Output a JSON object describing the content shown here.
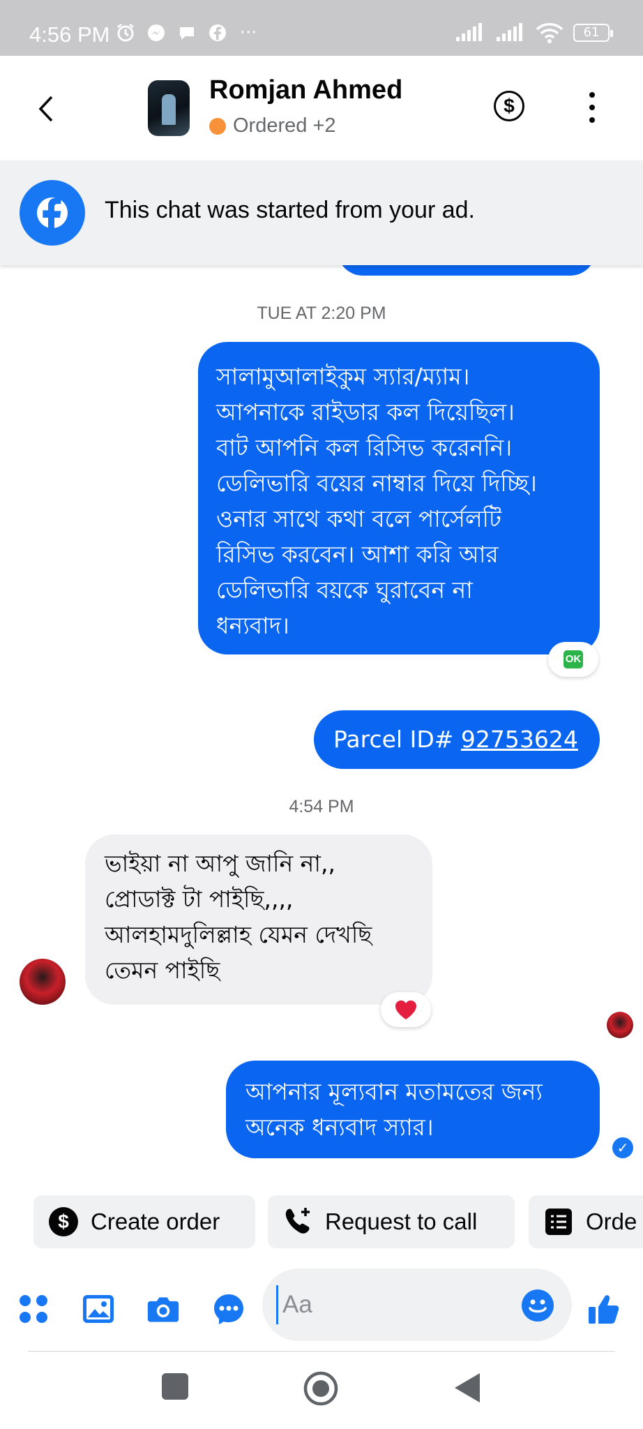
{
  "status_bar": {
    "time": "4:56 PM",
    "battery": "61"
  },
  "header": {
    "name": "Romjan Ahmed",
    "status": "Ordered +2"
  },
  "ad_banner": {
    "text": "This chat was started from your ad."
  },
  "messages": [
    {
      "time": "TUE AT 2:20 PM",
      "direction": "outgoing",
      "text": "সালামুআলাইকুম স্যার/ম্যাম।\nআপনাকে রাইডার কল দিয়েছিল।\nবাট আপনি কল রিসিভ করেননি।\nডেলিভারি বয়ের নাম্বার দিয়ে দিচ্ছি।\nওনার সাথে কথা বলে পার্সেলটি\nরিসিভ করবেন। আশা করি আর\nডেলিভারি বয়কে ঘুরাবেন না\nধন্যবাদ।",
      "reaction": "OK"
    },
    {
      "direction": "outgoing",
      "prefix": "Parcel ID# ",
      "link": "92753624"
    },
    {
      "time": "4:54 PM",
      "direction": "incoming",
      "text": "ভাইয়া না আপু জানি না,,\nপ্রোডাক্ট টা পাইছি,,,,\nআলহামদুলিল্লাহ যেমন দেখছি\nতেমন পাইছি",
      "reaction": "heart"
    },
    {
      "direction": "outgoing",
      "text": "আপনার মূল্যবান মতামতের জন্য\nঅনেক ধন্যবাদ স্যার।"
    }
  ],
  "quick_actions": [
    {
      "label": "Create order",
      "icon": "dollar-circle-icon"
    },
    {
      "label": "Request to call",
      "icon": "phone-plus-icon"
    },
    {
      "label": "Orde",
      "icon": "order-list-icon"
    }
  ],
  "composer": {
    "placeholder": "Aa"
  },
  "colors": {
    "accent": "#1877f2",
    "outgoing_bubble": "#0a66f0",
    "incoming_bubble": "#f0f0f2",
    "status_orange": "#f7923a",
    "ok_green": "#2cb34a",
    "heart_red": "#e41e3f"
  }
}
